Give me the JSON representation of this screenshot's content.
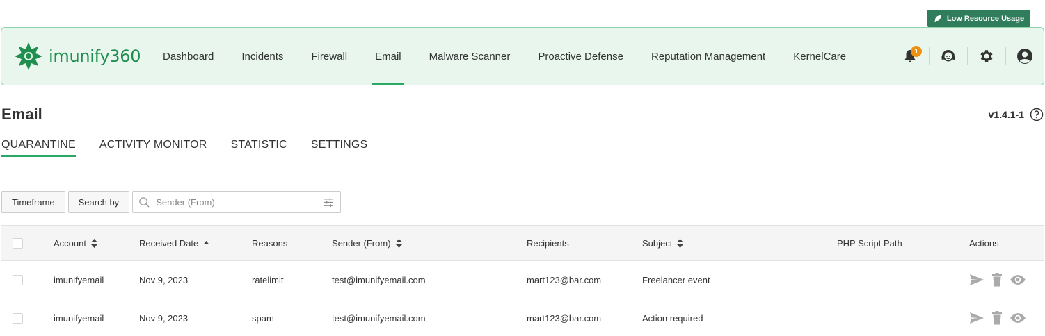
{
  "low_resource": {
    "label": "Low Resource Usage"
  },
  "brand": {
    "name": "imunify",
    "suffix": "360"
  },
  "nav": {
    "items": [
      {
        "label": "Dashboard"
      },
      {
        "label": "Incidents"
      },
      {
        "label": "Firewall"
      },
      {
        "label": "Email",
        "active": true
      },
      {
        "label": "Malware Scanner"
      },
      {
        "label": "Proactive Defense"
      },
      {
        "label": "Reputation Management"
      },
      {
        "label": "KernelCare"
      }
    ]
  },
  "header_icons": {
    "notifications_count": "1",
    "icons": [
      "bell-icon",
      "support-icon",
      "gear-icon",
      "user-icon"
    ]
  },
  "page": {
    "title": "Email",
    "version": "v1.4.1-1"
  },
  "tabs": [
    {
      "label": "QUARANTINE",
      "active": true
    },
    {
      "label": "ACTIVITY MONITOR"
    },
    {
      "label": "STATISTIC"
    },
    {
      "label": "SETTINGS"
    }
  ],
  "filters": {
    "timeframe_label": "Timeframe",
    "search_by_label": "Search by",
    "search_placeholder": "Sender (From)"
  },
  "table": {
    "columns": [
      {
        "label": "Account",
        "sort": "both"
      },
      {
        "label": "Received Date",
        "sort": "asc"
      },
      {
        "label": "Reasons"
      },
      {
        "label": "Sender (From)",
        "sort": "both"
      },
      {
        "label": "Recipients"
      },
      {
        "label": "Subject",
        "sort": "both"
      },
      {
        "label": "PHP Script Path"
      },
      {
        "label": "Actions"
      }
    ],
    "rows": [
      {
        "account": "imunifyemail",
        "received": "Nov 9, 2023",
        "reasons": "ratelimit",
        "sender": "test@imunifyemail.com",
        "recipients": "mart123@bar.com",
        "subject": "Freelancer event",
        "php_path": ""
      },
      {
        "account": "imunifyemail",
        "received": "Nov 9, 2023",
        "reasons": "spam",
        "sender": "test@imunifyemail.com",
        "recipients": "mart123@bar.com",
        "subject": "Action required",
        "php_path": ""
      }
    ],
    "row_actions": [
      "send-icon",
      "trash-icon",
      "eye-icon"
    ]
  },
  "colors": {
    "brand_green": "#2aa866",
    "topbar_bg": "#e8f6ee",
    "badge_orange": "#f0900f",
    "button_green": "#2f7d5a"
  }
}
